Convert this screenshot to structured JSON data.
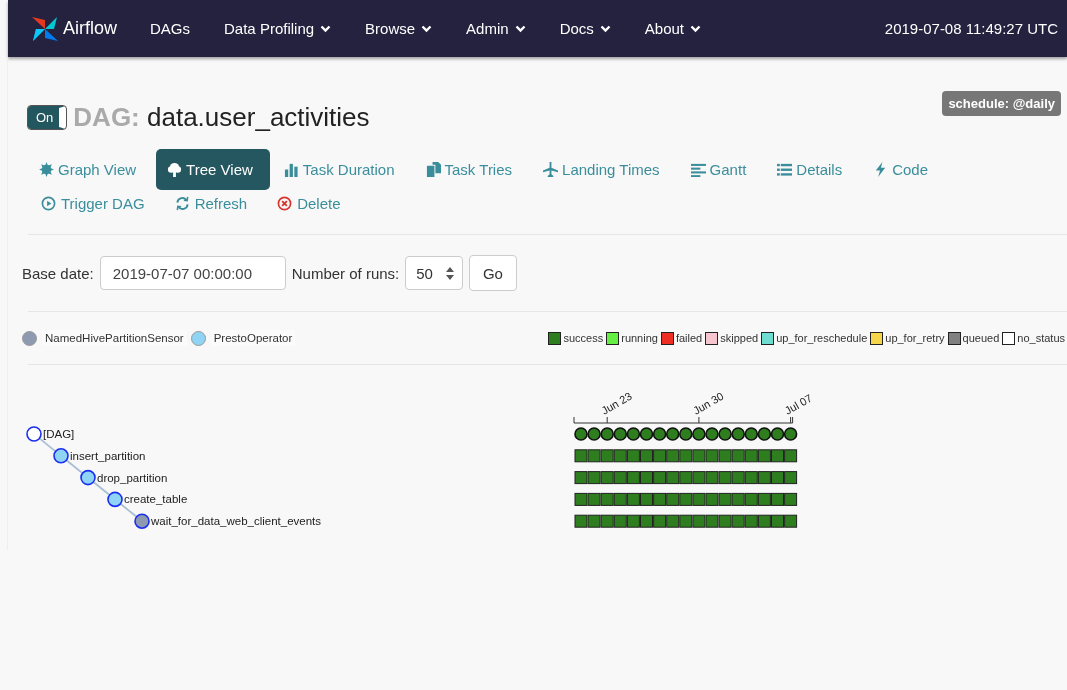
{
  "nav": {
    "brand": "Airflow",
    "items": [
      {
        "label": "DAGs",
        "dropdown": false
      },
      {
        "label": "Data Profiling",
        "dropdown": true
      },
      {
        "label": "Browse",
        "dropdown": true
      },
      {
        "label": "Admin",
        "dropdown": true
      },
      {
        "label": "Docs",
        "dropdown": true
      },
      {
        "label": "About",
        "dropdown": true
      }
    ],
    "time": "2019-07-08 11:49:27 UTC"
  },
  "dag": {
    "toggle_label": "On",
    "on": true,
    "prefix": "DAG:",
    "name": "data.user_activities",
    "schedule": "schedule: @daily"
  },
  "tabs": [
    {
      "label": "Graph View",
      "kind": "burst",
      "selected": false
    },
    {
      "label": "Tree View",
      "kind": "tree",
      "selected": true
    },
    {
      "label": "Task Duration",
      "kind": "bars",
      "selected": false
    },
    {
      "label": "Task Tries",
      "kind": "files",
      "selected": false
    },
    {
      "label": "Landing Times",
      "kind": "plane",
      "selected": false
    },
    {
      "label": "Gantt",
      "kind": "gantt",
      "selected": false
    },
    {
      "label": "Details",
      "kind": "list",
      "selected": false
    },
    {
      "label": "Code",
      "kind": "bolt",
      "selected": false
    }
  ],
  "actions": [
    {
      "label": "Trigger DAG",
      "kind": "play"
    },
    {
      "label": "Refresh",
      "kind": "refresh"
    },
    {
      "label": "Delete",
      "kind": "delete"
    }
  ],
  "form": {
    "base_date_label": "Base date:",
    "base_date": "2019-07-07 00:00:00",
    "runs_label": "Number of runs:",
    "runs": "50",
    "go": "Go"
  },
  "operators": [
    {
      "name": "NamedHivePartitionSensor",
      "color": "#8e9aaf"
    },
    {
      "name": "PrestoOperator",
      "color": "#8fd3f5"
    }
  ],
  "states": [
    {
      "name": "success",
      "color": "#2e7d1f"
    },
    {
      "name": "running",
      "color": "#66ee44"
    },
    {
      "name": "failed",
      "color": "#ee2e22"
    },
    {
      "name": "skipped",
      "color": "#f5c6d0"
    },
    {
      "name": "up_for_reschedule",
      "color": "#6fdccf"
    },
    {
      "name": "up_for_retry",
      "color": "#f5d54a"
    },
    {
      "name": "queued",
      "color": "#808080"
    },
    {
      "name": "no_status",
      "color": "#ffffff"
    }
  ],
  "tree": {
    "label": "[DAG]",
    "color": "#ffffff",
    "runs": [
      {
        "color": "#2e7d1f"
      },
      {
        "color": "#2e7d1f"
      },
      {
        "color": "#2e7d1f",
        "tick": "Jun 23"
      },
      {
        "color": "#2e7d1f"
      },
      {
        "color": "#2e7d1f"
      },
      {
        "color": "#2e7d1f"
      },
      {
        "color": "#2e7d1f"
      },
      {
        "color": "#2e7d1f"
      },
      {
        "color": "#2e7d1f"
      },
      {
        "color": "#2e7d1f",
        "tick": "Jun 30"
      },
      {
        "color": "#2e7d1f"
      },
      {
        "color": "#2e7d1f"
      },
      {
        "color": "#2e7d1f"
      },
      {
        "color": "#2e7d1f"
      },
      {
        "color": "#2e7d1f"
      },
      {
        "color": "#2e7d1f"
      },
      {
        "color": "#2e7d1f",
        "tick": "Jul 07"
      }
    ],
    "children": [
      {
        "label": "insert_partition",
        "color": "#8fd3f5",
        "runs": [
          {
            "color": "#2e7d1f"
          },
          {
            "color": "#2e7d1f"
          },
          {
            "color": "#2e7d1f"
          },
          {
            "color": "#2e7d1f"
          },
          {
            "color": "#2e7d1f"
          },
          {
            "color": "#2e7d1f"
          },
          {
            "color": "#2e7d1f"
          },
          {
            "color": "#2e7d1f"
          },
          {
            "color": "#2e7d1f"
          },
          {
            "color": "#2e7d1f"
          },
          {
            "color": "#2e7d1f"
          },
          {
            "color": "#2e7d1f"
          },
          {
            "color": "#2e7d1f"
          },
          {
            "color": "#2e7d1f"
          },
          {
            "color": "#2e7d1f"
          },
          {
            "color": "#2e7d1f"
          },
          {
            "color": "#2e7d1f"
          }
        ],
        "children": [
          {
            "label": "drop_partition",
            "color": "#8fd3f5",
            "runs": [
              {
                "color": "#2e7d1f"
              },
              {
                "color": "#2e7d1f"
              },
              {
                "color": "#2e7d1f"
              },
              {
                "color": "#2e7d1f"
              },
              {
                "color": "#2e7d1f"
              },
              {
                "color": "#2e7d1f"
              },
              {
                "color": "#2e7d1f"
              },
              {
                "color": "#2e7d1f"
              },
              {
                "color": "#2e7d1f"
              },
              {
                "color": "#2e7d1f"
              },
              {
                "color": "#2e7d1f"
              },
              {
                "color": "#2e7d1f"
              },
              {
                "color": "#2e7d1f"
              },
              {
                "color": "#2e7d1f"
              },
              {
                "color": "#2e7d1f"
              },
              {
                "color": "#2e7d1f"
              },
              {
                "color": "#2e7d1f"
              }
            ],
            "children": [
              {
                "label": "create_table",
                "color": "#8fd3f5",
                "runs": [
                  {
                    "color": "#2e7d1f"
                  },
                  {
                    "color": "#2e7d1f"
                  },
                  {
                    "color": "#2e7d1f"
                  },
                  {
                    "color": "#2e7d1f"
                  },
                  {
                    "color": "#2e7d1f"
                  },
                  {
                    "color": "#2e7d1f"
                  },
                  {
                    "color": "#2e7d1f"
                  },
                  {
                    "color": "#2e7d1f"
                  },
                  {
                    "color": "#2e7d1f"
                  },
                  {
                    "color": "#2e7d1f"
                  },
                  {
                    "color": "#2e7d1f"
                  },
                  {
                    "color": "#2e7d1f"
                  },
                  {
                    "color": "#2e7d1f"
                  },
                  {
                    "color": "#2e7d1f"
                  },
                  {
                    "color": "#2e7d1f"
                  },
                  {
                    "color": "#2e7d1f"
                  },
                  {
                    "color": "#2e7d1f"
                  }
                ],
                "children": [
                  {
                    "label": "wait_for_data_web_client_events",
                    "color": "#8e9aaf",
                    "runs": [
                      {
                        "color": "#2e7d1f"
                      },
                      {
                        "color": "#2e7d1f"
                      },
                      {
                        "color": "#2e7d1f"
                      },
                      {
                        "color": "#2e7d1f"
                      },
                      {
                        "color": "#2e7d1f"
                      },
                      {
                        "color": "#2e7d1f"
                      },
                      {
                        "color": "#2e7d1f"
                      },
                      {
                        "color": "#2e7d1f"
                      },
                      {
                        "color": "#2e7d1f"
                      },
                      {
                        "color": "#2e7d1f"
                      },
                      {
                        "color": "#2e7d1f"
                      },
                      {
                        "color": "#2e7d1f"
                      },
                      {
                        "color": "#2e7d1f"
                      },
                      {
                        "color": "#2e7d1f"
                      },
                      {
                        "color": "#2e7d1f"
                      },
                      {
                        "color": "#2e7d1f"
                      },
                      {
                        "color": "#2e7d1f"
                      }
                    ]
                  }
                ]
              }
            ]
          }
        ]
      }
    ]
  }
}
